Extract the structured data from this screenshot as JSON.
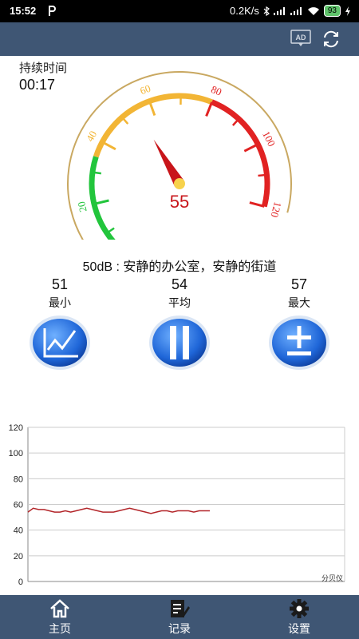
{
  "status_bar": {
    "time": "15:52",
    "speed": "0.2K/s",
    "battery": "93"
  },
  "duration": {
    "label": "持续时间",
    "value": "00:17"
  },
  "gauge": {
    "min": 0,
    "max": 120,
    "ticks": [
      "0",
      "20",
      "40",
      "60",
      "80",
      "100",
      "120"
    ],
    "reading": "55",
    "needle_value": 55
  },
  "description": "50dB : 安静的办公室，安静的街道",
  "stats": [
    {
      "value": "51",
      "label": "最小"
    },
    {
      "value": "54",
      "label": "平均"
    },
    {
      "value": "57",
      "label": "最大"
    }
  ],
  "chart_data": {
    "type": "line",
    "y_ticks": [
      "120",
      "100",
      "80",
      "60",
      "40",
      "20",
      "0"
    ],
    "ylim": [
      0,
      120
    ],
    "annotation": "分贝仪",
    "series": [
      {
        "values": [
          54,
          57,
          56,
          56,
          55,
          54,
          54,
          55,
          54,
          55,
          56,
          57,
          56,
          55,
          54,
          54,
          54,
          55,
          56,
          57,
          56,
          55,
          54,
          53,
          54,
          55,
          55,
          54,
          55,
          55,
          55,
          54,
          55,
          55,
          55
        ]
      }
    ]
  },
  "bottom_nav": [
    {
      "label": "主页"
    },
    {
      "label": "记录"
    },
    {
      "label": "设置"
    }
  ]
}
